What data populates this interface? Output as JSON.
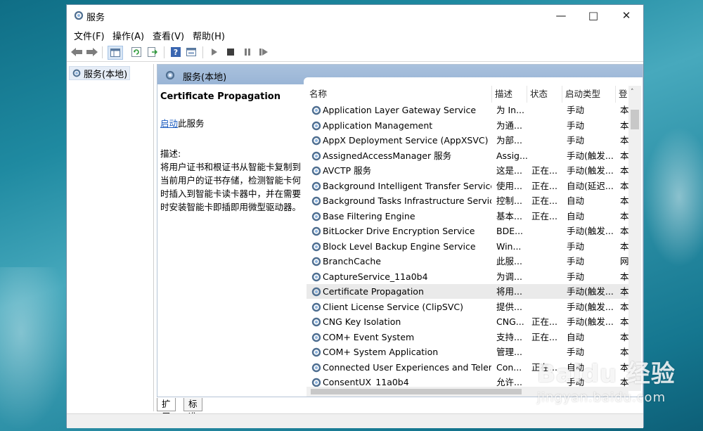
{
  "window": {
    "title": "服务"
  },
  "menu": {
    "file": "文件(F)",
    "action": "操作(A)",
    "view": "查看(V)",
    "help": "帮助(H)"
  },
  "tree": {
    "root_label": "服务(本地)"
  },
  "pane": {
    "title": "服务(本地)"
  },
  "description": {
    "service_name": "Certificate Propagation",
    "start_link": "启动",
    "start_suffix": "此服务",
    "label": "描述:",
    "text": "将用户证书和根证书从智能卡复制到当前用户的证书存储，检测智能卡何时插入到智能卡读卡器中，并在需要时安装智能卡即插即用微型驱动器。"
  },
  "columns": {
    "name": "名称",
    "desc": "描述",
    "state": "状态",
    "startup": "启动类型",
    "logon": "登"
  },
  "services": [
    {
      "name": "Application Layer Gateway Service",
      "desc": "为 In...",
      "state": "",
      "startup": "手动",
      "logon": "本"
    },
    {
      "name": "Application Management",
      "desc": "为通...",
      "state": "",
      "startup": "手动",
      "logon": "本"
    },
    {
      "name": "AppX Deployment Service (AppXSVC)",
      "desc": "为部...",
      "state": "",
      "startup": "手动",
      "logon": "本"
    },
    {
      "name": "AssignedAccessManager 服务",
      "desc": "Assig...",
      "state": "",
      "startup": "手动(触发...",
      "logon": "本"
    },
    {
      "name": "AVCTP 服务",
      "desc": "这是...",
      "state": "正在...",
      "startup": "手动(触发...",
      "logon": "本"
    },
    {
      "name": "Background Intelligent Transfer Service",
      "desc": "使用...",
      "state": "正在...",
      "startup": "自动(延迟...",
      "logon": "本"
    },
    {
      "name": "Background Tasks Infrastructure Service",
      "desc": "控制...",
      "state": "正在...",
      "startup": "自动",
      "logon": "本"
    },
    {
      "name": "Base Filtering Engine",
      "desc": "基本...",
      "state": "正在...",
      "startup": "自动",
      "logon": "本"
    },
    {
      "name": "BitLocker Drive Encryption Service",
      "desc": "BDE...",
      "state": "",
      "startup": "手动(触发...",
      "logon": "本"
    },
    {
      "name": "Block Level Backup Engine Service",
      "desc": "Win...",
      "state": "",
      "startup": "手动",
      "logon": "本"
    },
    {
      "name": "BranchCache",
      "desc": "此服...",
      "state": "",
      "startup": "手动",
      "logon": "网"
    },
    {
      "name": "CaptureService_11a0b4",
      "desc": "为调...",
      "state": "",
      "startup": "手动",
      "logon": "本"
    },
    {
      "name": "Certificate Propagation",
      "desc": "将用...",
      "state": "",
      "startup": "手动(触发...",
      "logon": "本",
      "selected": true
    },
    {
      "name": "Client License Service (ClipSVC)",
      "desc": "提供...",
      "state": "",
      "startup": "手动(触发...",
      "logon": "本"
    },
    {
      "name": "CNG Key Isolation",
      "desc": "CNG...",
      "state": "正在...",
      "startup": "手动(触发...",
      "logon": "本"
    },
    {
      "name": "COM+ Event System",
      "desc": "支持...",
      "state": "正在...",
      "startup": "自动",
      "logon": "本"
    },
    {
      "name": "COM+ System Application",
      "desc": "管理...",
      "state": "",
      "startup": "手动",
      "logon": "本"
    },
    {
      "name": "Connected User Experiences and Teleme...",
      "desc": "Con...",
      "state": "正在...",
      "startup": "自动",
      "logon": "本"
    },
    {
      "name": "ConsentUX_11a0b4",
      "desc": "允许...",
      "state": "",
      "startup": "手动",
      "logon": "本"
    }
  ],
  "tabs": {
    "extended": "扩展",
    "standard": "标准"
  },
  "watermark": {
    "logo": "Baidu 经验",
    "url": "jingyan.baidu.com"
  },
  "colors": {
    "header_blue": "#9ab5d6",
    "link_blue": "#1a5bbf",
    "selected_row": "#eaeaea"
  }
}
